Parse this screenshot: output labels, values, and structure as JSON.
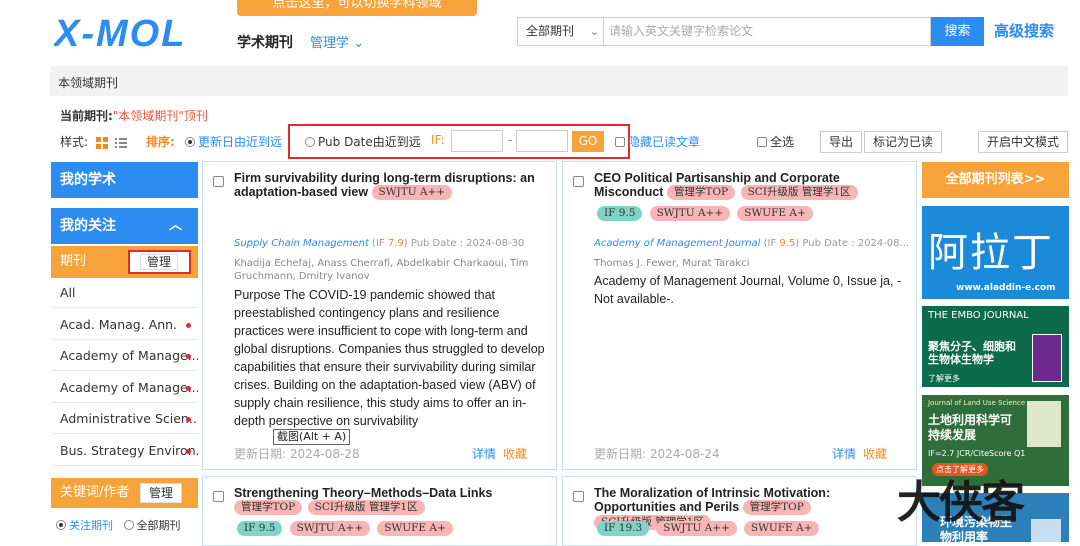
{
  "header": {
    "logo_text": "X-MOL",
    "brand": "学术期刊",
    "field_label": "管理学",
    "tooltip": "点击这里，可以切换学科领域",
    "journal_type": "全部期刊",
    "search_placeholder": "请输入英文关键字检索论文",
    "search_button": "搜索",
    "advanced_search": "高级搜索"
  },
  "breadcrumb": "本领域期刊",
  "current_journal": {
    "label": "当前期刊:",
    "value": "\"本领域期刊\"顶刊"
  },
  "filters": {
    "style_label": "样式:",
    "sort_label": "排序:",
    "sort_update": "更新日由近到远",
    "sort_pubdate": "Pub Date由近到远",
    "if_label": "IF:",
    "if_sep": "-",
    "go_button": "GO",
    "hide_read": "隐藏已读文章",
    "select_all": "全选",
    "export": "导出",
    "mark_read": "标记为已读",
    "chinese_mode": "开启中文模式"
  },
  "left_sidebar": {
    "my_academic": "我的学术",
    "my_follow": "我的关注",
    "journal_header": "期刊",
    "manage": "管理",
    "journals": [
      "All",
      "Acad. Manag. Ann.",
      "Academy of Manage...",
      "Academy of Manage...",
      "Administrative Scien...",
      "Bus. Strategy Environ..."
    ],
    "keyword_header": "关键词/作者",
    "keyword_manage": "管理",
    "radio_follow": "关注期刊",
    "radio_all": "全部期刊"
  },
  "cards": [
    {
      "title": "Firm survivability during long-term disruptions: an adaptation-based view",
      "tags": [
        "SWJTU A++"
      ],
      "journal": "Supply Chain Management",
      "if_prefix": " (IF ",
      "if_value": "7.9",
      "if_suffix": ")",
      "pub_date": " Pub Date : 2024-08-30",
      "authors": "Khadija Echefaj, Anass Cherrafi, Abdelkabir Charkaoui, Tim Gruchmann, Dmitry Ivanov",
      "abstract": "Purpose The COVID-19 pandemic showed that preestablished contingency plans and resilience practices were insufficient to cope with long-term and global disruptions. Companies thus struggled to develop capabilities that ensure their survivability during similar crises. Building on the adaptation-based view (ABV) of supply chain resilience, this study aims to offer an in-depth perspective on survivability",
      "updated": "更新日期: 2024-08-28",
      "detail": "详情",
      "favorite": "收藏"
    },
    {
      "title": "CEO Political Partisanship and Corporate Misconduct",
      "tags": [
        "管理学TOP",
        "SCI升级版 管理学1区"
      ],
      "tags2_if": "IF 9.5",
      "tags2": [
        "SWJTU A++",
        "SWUFE A+"
      ],
      "journal": "Academy of Management Journal",
      "if_prefix": " (IF ",
      "if_value": "9.5",
      "if_suffix": ")",
      "pub_date": " Pub Date : 2024-08...",
      "authors": "Thomas J. Fewer, Murat Tarakci",
      "abstract": "Academy of Management Journal, Volume 0, Issue ja, -Not available-.",
      "updated": "更新日期: 2024-08-24",
      "detail": "详情",
      "favorite": "收藏"
    },
    {
      "title": "Strengthening Theory–Methods–Data Links",
      "tags": [
        "管理学TOP",
        "SCI升级版 管理学1区"
      ],
      "tags2_if": "IF 9.5",
      "tags2": [
        "SWJTU A++",
        "SWUFE A+"
      ]
    },
    {
      "title": "The Moralization of Intrinsic Motivation: Opportunities and Perils",
      "tags": [
        "管理学TOP",
        "SCI升级版 管理学1区"
      ],
      "tags2_if": "IF 19.3",
      "tags2": [
        "SWJTU A++",
        "SWUFE A+"
      ]
    }
  ],
  "screenshot_tip": "截图(Alt + A)",
  "right_sidebar": {
    "all_list": "全部期刊列表>>",
    "ad1_big": "阿拉丁",
    "ad1_url": "www.aladdin-e.com",
    "ad2_brand": "THE EMBO JOURNAL",
    "ad2_text": "聚焦分子、细胞和生物体生物学",
    "ad2_more": "了解更多",
    "ad3_journal": "Journal of Land Use Science",
    "ad3_text": "土地利用科学可持续发展",
    "ad3_metrics": "IF=2.7 JCR/CiteScore Q1",
    "ad3_more": "点击了解更多",
    "ad4_text": "环境污染物生物利用率"
  },
  "watermark": "大侠客",
  "colors": {
    "blue": "#2d8cf0",
    "orange": "#f7a33b",
    "red_box": "#e02b2b",
    "tag_pink": "#f7b5b5",
    "tag_teal": "#7fd3c7"
  }
}
